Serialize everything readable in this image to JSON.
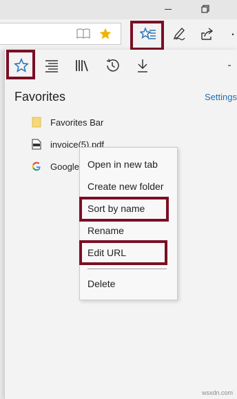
{
  "window": {
    "restore_icon": "restore-window-icon",
    "more_icon": "more-ellipsis-icon"
  },
  "toolbar": {
    "reading_view_icon": "reading-view-icon",
    "add_favorite_icon": "star-filled-icon",
    "hub_icon": "hub-star-list-icon",
    "notes_icon": "pen-notes-icon",
    "share_icon": "share-icon",
    "more": "·"
  },
  "hub": {
    "tabs": [
      {
        "icon": "star-outline-icon",
        "name": "favorites"
      },
      {
        "icon": "reading-list-icon",
        "name": "reading-list"
      },
      {
        "icon": "books-icon",
        "name": "books"
      },
      {
        "icon": "history-icon",
        "name": "history"
      },
      {
        "icon": "download-icon",
        "name": "downloads"
      }
    ],
    "pin_dash": "-",
    "title": "Favorites",
    "settings_label": "Settings",
    "items": [
      {
        "label": "Favorites Bar",
        "icon": "folder-icon"
      },
      {
        "label": "invoice(5).pdf",
        "icon": "pdf-icon"
      },
      {
        "label": "Google",
        "icon": "google-icon"
      }
    ]
  },
  "context_menu": {
    "items": [
      "Open in new tab",
      "Create new folder",
      "Sort by name",
      "Rename",
      "Edit URL",
      "Delete"
    ]
  },
  "colors": {
    "highlight": "#7a0f24",
    "accent": "#1e6fb5",
    "star": "#f0b400"
  },
  "watermark": "wsxdn.com"
}
